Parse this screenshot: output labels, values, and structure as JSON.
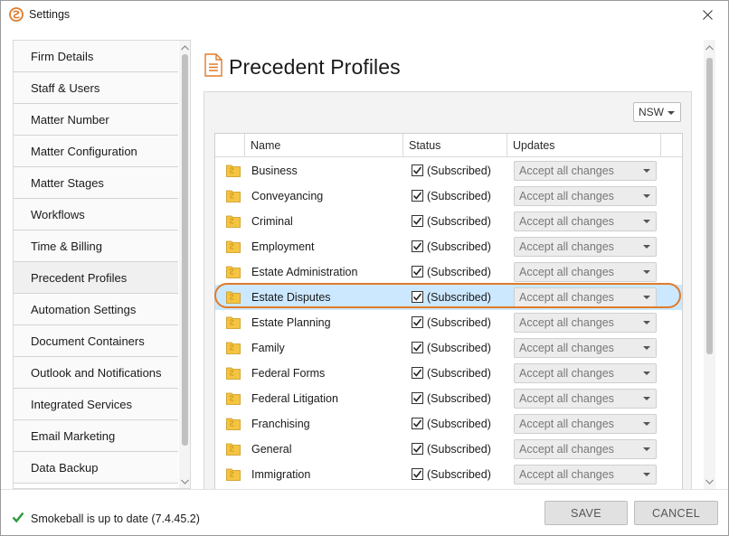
{
  "window": {
    "title": "Settings"
  },
  "sidebar": {
    "items": [
      {
        "label": "Firm Details",
        "active": false
      },
      {
        "label": "Staff & Users",
        "active": false
      },
      {
        "label": "Matter Number",
        "active": false
      },
      {
        "label": "Matter Configuration",
        "active": false
      },
      {
        "label": "Matter Stages",
        "active": false
      },
      {
        "label": "Workflows",
        "active": false
      },
      {
        "label": "Time & Billing",
        "active": false
      },
      {
        "label": "Precedent Profiles",
        "active": true
      },
      {
        "label": "Automation Settings",
        "active": false
      },
      {
        "label": "Document Containers",
        "active": false
      },
      {
        "label": "Outlook and Notifications",
        "active": false
      },
      {
        "label": "Integrated Services",
        "active": false
      },
      {
        "label": "Email Marketing",
        "active": false
      },
      {
        "label": "Data Backup",
        "active": false
      }
    ]
  },
  "main": {
    "title": "Precedent Profiles",
    "region": "NSW",
    "columns": {
      "name": "Name",
      "status": "Status",
      "updates": "Updates"
    },
    "rows": [
      {
        "name": "Business",
        "checked": true,
        "status": "(Subscribed)",
        "updates": "Accept all changes",
        "selected": false
      },
      {
        "name": "Conveyancing",
        "checked": true,
        "status": "(Subscribed)",
        "updates": "Accept all changes",
        "selected": false
      },
      {
        "name": "Criminal",
        "checked": true,
        "status": "(Subscribed)",
        "updates": "Accept all changes",
        "selected": false
      },
      {
        "name": "Employment",
        "checked": true,
        "status": "(Subscribed)",
        "updates": "Accept all changes",
        "selected": false
      },
      {
        "name": "Estate Administration",
        "checked": true,
        "status": "(Subscribed)",
        "updates": "Accept all changes",
        "selected": false
      },
      {
        "name": "Estate Disputes",
        "checked": true,
        "status": "(Subscribed)",
        "updates": "Accept all changes",
        "selected": true
      },
      {
        "name": "Estate Planning",
        "checked": true,
        "status": "(Subscribed)",
        "updates": "Accept all changes",
        "selected": false
      },
      {
        "name": "Family",
        "checked": true,
        "status": "(Subscribed)",
        "updates": "Accept all changes",
        "selected": false
      },
      {
        "name": "Federal Forms",
        "checked": true,
        "status": "(Subscribed)",
        "updates": "Accept all changes",
        "selected": false
      },
      {
        "name": "Federal Litigation",
        "checked": true,
        "status": "(Subscribed)",
        "updates": "Accept all changes",
        "selected": false
      },
      {
        "name": "Franchising",
        "checked": true,
        "status": "(Subscribed)",
        "updates": "Accept all changes",
        "selected": false
      },
      {
        "name": "General",
        "checked": true,
        "status": "(Subscribed)",
        "updates": "Accept all changes",
        "selected": false
      },
      {
        "name": "Immigration",
        "checked": true,
        "status": "(Subscribed)",
        "updates": "Accept all changes",
        "selected": false
      }
    ]
  },
  "footer": {
    "status": "Smokeball is up to date (7.4.45.2)",
    "save_label": "SAVE",
    "cancel_label": "CANCEL"
  },
  "colors": {
    "accent": "#e07b2a",
    "selected_row": "#cce8ff",
    "folder": "#f5c542",
    "status_ok": "#2e9a3c"
  }
}
